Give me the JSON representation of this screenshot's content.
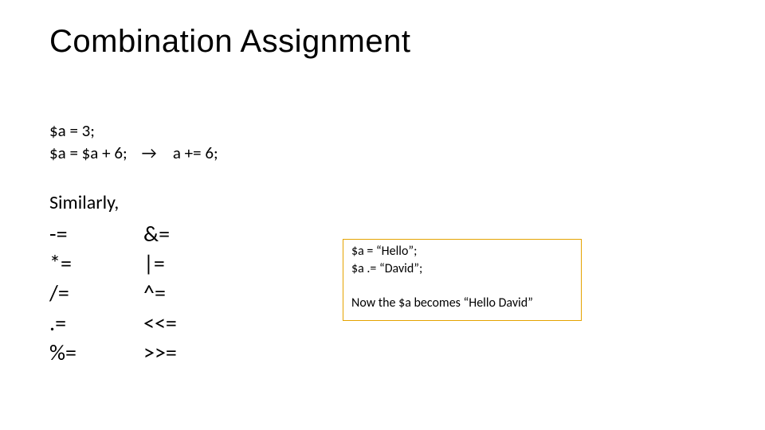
{
  "title": "Combination Assignment",
  "intro": {
    "line1": "$a = 3;",
    "line2a": "$a = $a + 6;",
    "arrow": "→",
    "line2b": "a += 6;"
  },
  "similarly": "Similarly,",
  "ops_col1": [
    "-=",
    "*=",
    "/=",
    ".=",
    "%="
  ],
  "ops_col2": [
    "&=",
    "|=",
    "^=",
    "<<=",
    ">>="
  ],
  "example": {
    "line1": "$a = “Hello”;",
    "line2": "$a .= “David”;",
    "result": "Now the $a becomes “Hello David”"
  }
}
